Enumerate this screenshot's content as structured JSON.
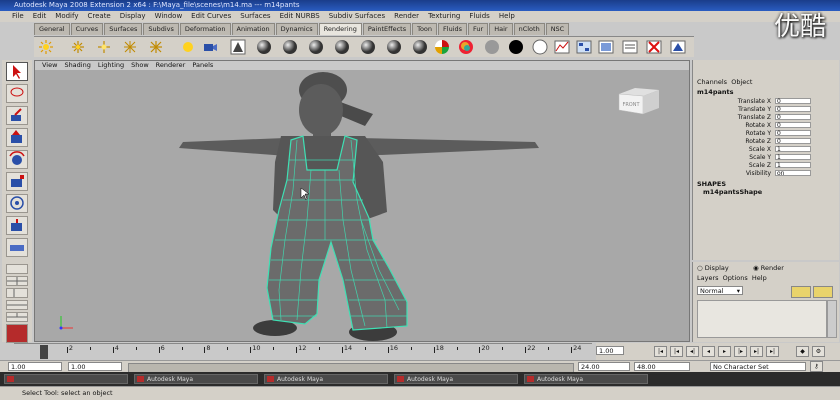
{
  "window_title": "Autodesk Maya 2008 Extension 2 x64 : F:\\Maya_file\\scenes\\m14.ma  ---  m14pants",
  "menu": [
    "File",
    "Edit",
    "Modify",
    "Create",
    "Display",
    "Window",
    "Edit Curves",
    "Surfaces",
    "Edit NURBS",
    "Subdiv Surfaces",
    "Render",
    "Texturing",
    "Fluids",
    "Help"
  ],
  "shelf_tabs": [
    "General",
    "Curves",
    "Surfaces",
    "Subdivs",
    "Deformation",
    "Animation",
    "Dynamics",
    "Rendering",
    "PaintEffects",
    "Toon",
    "Fluids",
    "Fur",
    "Hair",
    "nCloth",
    "NSC"
  ],
  "active_shelf_tab": "Rendering",
  "panel_menu": [
    "View",
    "Shading",
    "Lighting",
    "Show",
    "Renderer",
    "Panels"
  ],
  "view_cube_label": "FRONT",
  "channel_box": {
    "header_tabs": [
      "Channels",
      "Object"
    ],
    "object_name": "m14pants",
    "attributes": [
      {
        "name": "Translate X",
        "value": "0"
      },
      {
        "name": "Translate Y",
        "value": "0"
      },
      {
        "name": "Translate Z",
        "value": "0"
      },
      {
        "name": "Rotate X",
        "value": "0"
      },
      {
        "name": "Rotate Y",
        "value": "0"
      },
      {
        "name": "Rotate Z",
        "value": "0"
      },
      {
        "name": "Scale X",
        "value": "1"
      },
      {
        "name": "Scale Y",
        "value": "1"
      },
      {
        "name": "Scale Z",
        "value": "1"
      },
      {
        "name": "Visibility",
        "value": "on"
      }
    ],
    "shapes_label": "SHAPES",
    "shape_name": "m14pantsShape"
  },
  "layer_panel": {
    "display_label": "Display",
    "render_label": "Render",
    "menu": [
      "Layers",
      "Options",
      "Help"
    ],
    "mode_value": "Normal"
  },
  "timeline": {
    "ticks": [
      "2",
      "4",
      "6",
      "8",
      "10",
      "12",
      "14",
      "16",
      "18",
      "20",
      "22",
      "24"
    ],
    "current_frame": "1.00"
  },
  "range": {
    "start": "1.00",
    "range_start": "1.00",
    "range_end": "24.00",
    "end": "48.00",
    "character_set": "No Character Set"
  },
  "taskbar_items": [
    "",
    "Autodesk Maya",
    "Autodesk Maya",
    "Autodesk Maya",
    "Autodesk Maya"
  ],
  "help_line": "Select Tool: select an object",
  "watermark": "优酷"
}
